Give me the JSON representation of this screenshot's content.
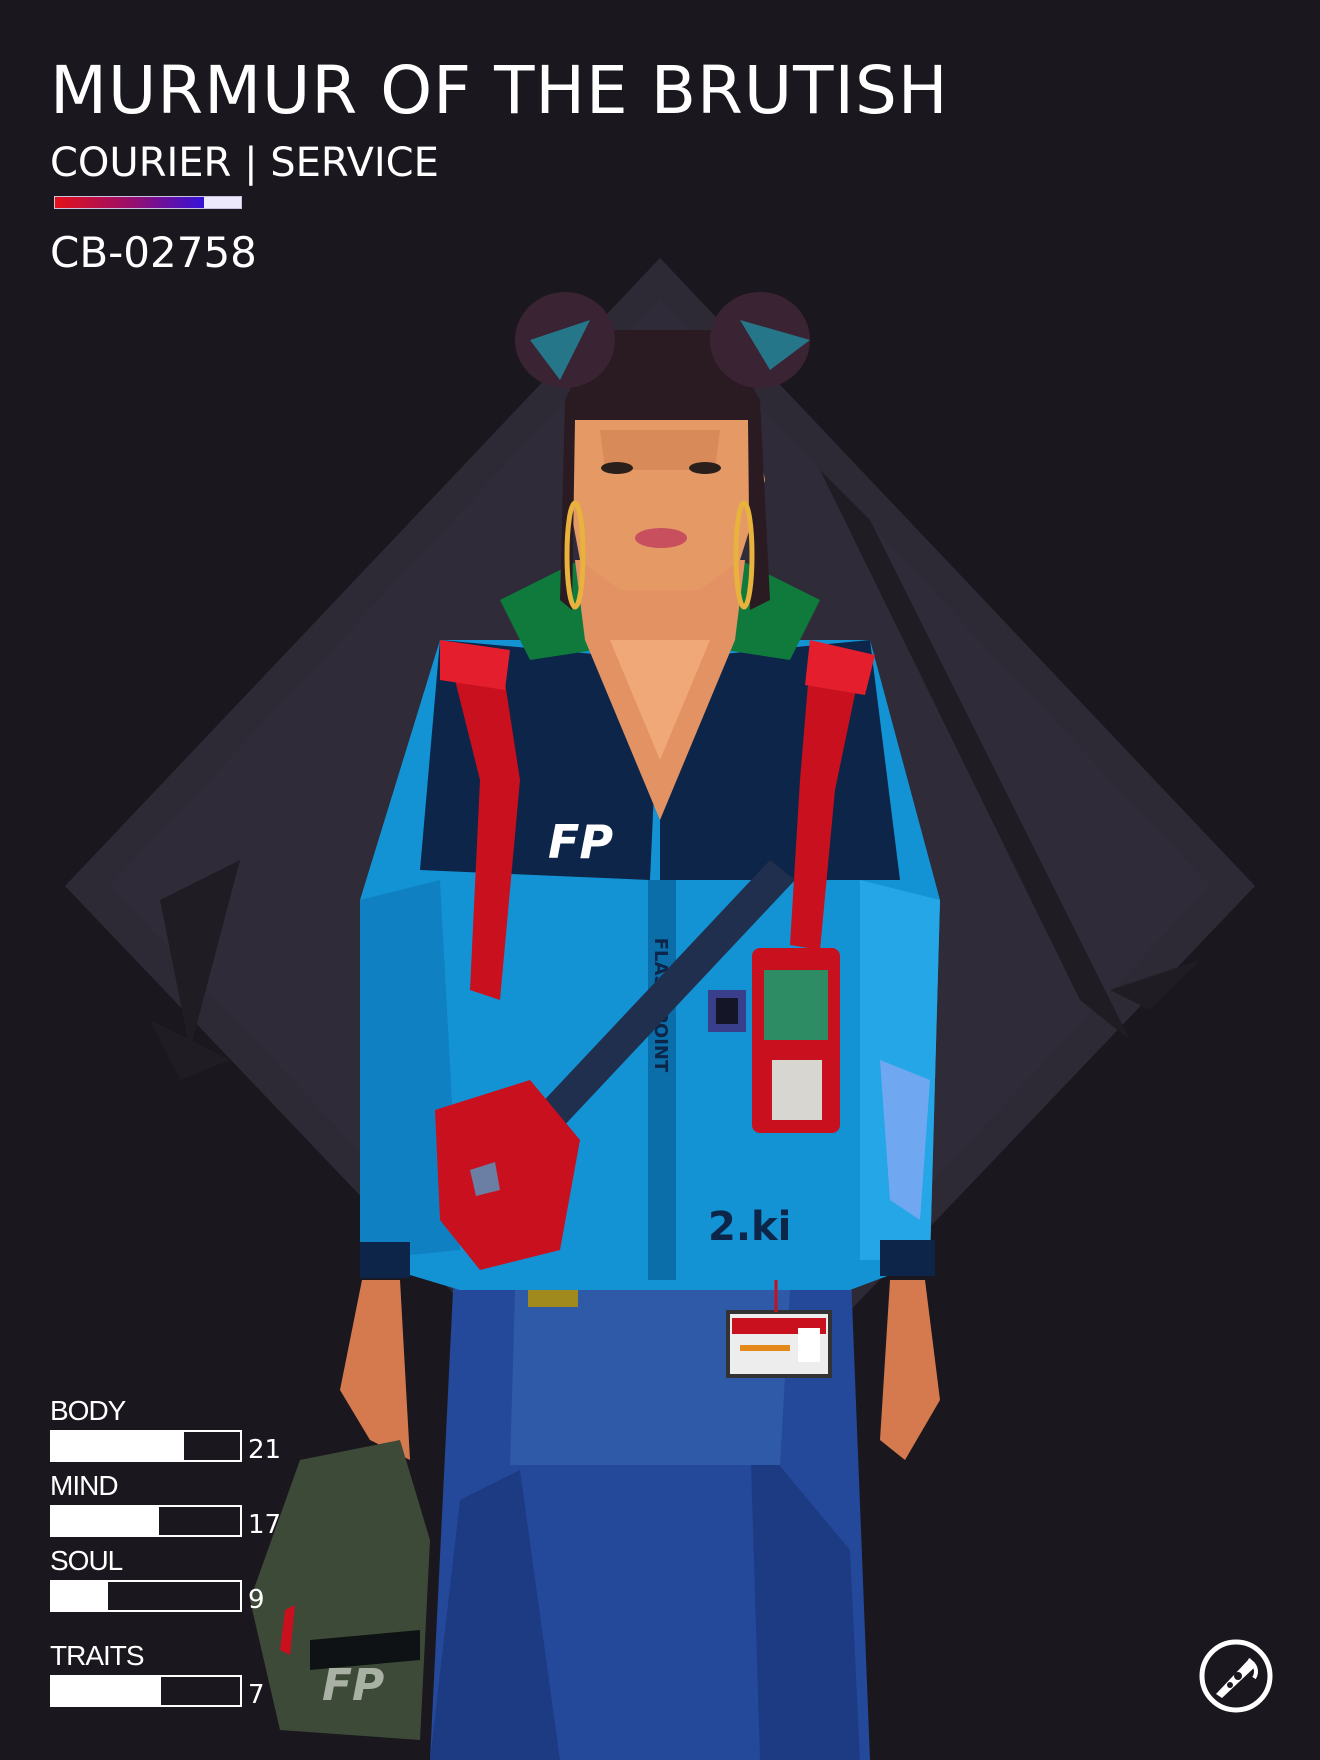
{
  "character": {
    "name": "MURMUR OF THE BRUTISH",
    "class": "COURIER | SERVICE",
    "serial": "CB-02758"
  },
  "stats": [
    {
      "label": "BODY",
      "value": "21",
      "fill": 0.7
    },
    {
      "label": "MIND",
      "value": "17",
      "fill": 0.57
    },
    {
      "label": "SOUL",
      "value": "9",
      "fill": 0.3
    },
    {
      "label": "TRAITS",
      "value": "7",
      "fill": 0.58
    }
  ],
  "artwork": {
    "jacket_text": "FLASH POINT",
    "chest_badge": "FP",
    "bag_badge": "FP",
    "pocket_text": "2.ki"
  },
  "colors": {
    "background": "#1a181e",
    "diamond": "#2d2935",
    "jacket": "#1493d4",
    "jacket_dark": "#0d2548",
    "pants": "#24489a",
    "strap": "#c8101e",
    "accent_red": "#e4101a",
    "accent_blue": "#3512d8"
  },
  "icons": {
    "logo": "pizza-slice-icon"
  }
}
